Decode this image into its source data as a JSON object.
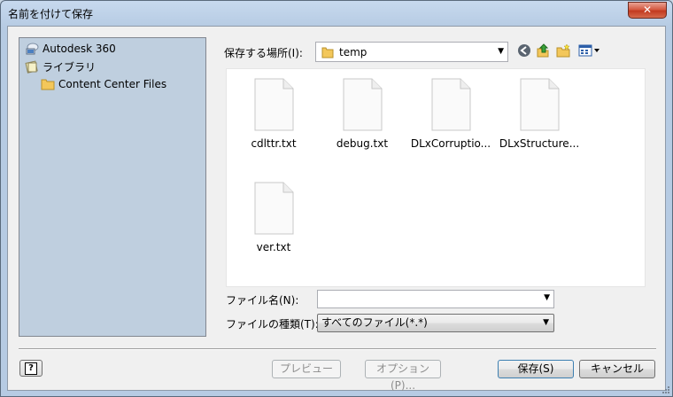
{
  "window": {
    "title": "名前を付けて保存",
    "close_symbol": "✕"
  },
  "places": {
    "items": [
      {
        "label": "Autodesk 360",
        "icon": "cloud-computer-icon"
      },
      {
        "label": "ライブラリ",
        "icon": "library-icon"
      },
      {
        "label": "Content Center Files",
        "icon": "folder-icon"
      }
    ]
  },
  "location": {
    "label": "保存する場所(I):",
    "value": "temp",
    "icon": "folder-icon"
  },
  "toolbar": {
    "back_icon": "back-arrow-icon",
    "up_icon": "up-folder-icon",
    "new_folder_icon": "new-folder-icon",
    "view_icon": "view-menu-icon"
  },
  "files": [
    {
      "name": "cdlttr.txt"
    },
    {
      "name": "debug.txt"
    },
    {
      "name": "DLxCorruptio..."
    },
    {
      "name": "DLxStructure..."
    },
    {
      "name": "ver.txt"
    }
  ],
  "filename": {
    "label": "ファイル名(N):",
    "value": ""
  },
  "filetype": {
    "label": "ファイルの種類(T):",
    "value": "すべてのファイル(*.*)"
  },
  "buttons": {
    "help": "?",
    "preview": "プレビュー",
    "options": "オプション(P)...",
    "save": "保存(S)",
    "cancel": "キャンセル"
  },
  "colors": {
    "places_bg": "#bfcfdf",
    "folder": "#f3c75a",
    "title_bar": "#b6cbe3",
    "close_button": "#c23a1f"
  }
}
